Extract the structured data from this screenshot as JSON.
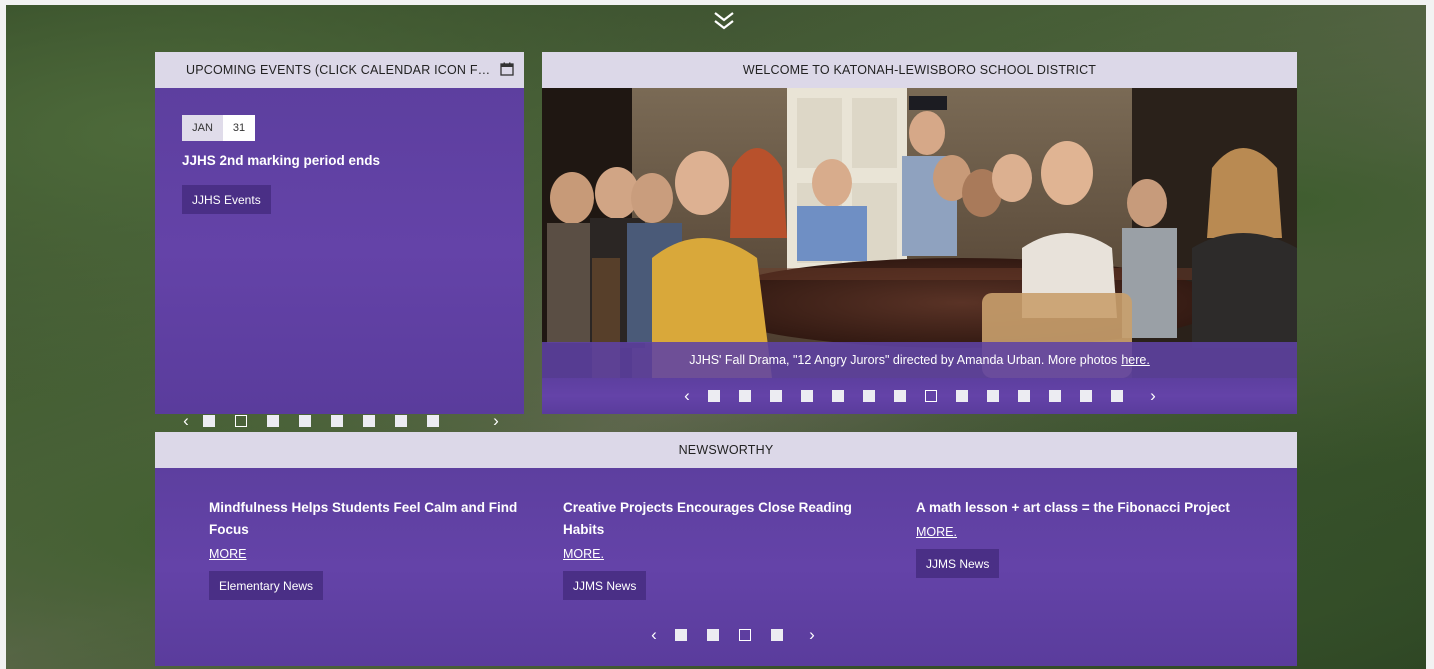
{
  "events": {
    "header": "UPCOMING EVENTS (CLICK CALENDAR ICON FOR ...",
    "event": {
      "month": "JAN",
      "day": "31",
      "title": "JJHS 2nd marking period ends",
      "tag": "JJHS Events"
    },
    "pager": {
      "prev": "‹",
      "next": "›",
      "count": 8,
      "active_index": 1
    }
  },
  "welcome": {
    "header": "WELCOME TO KATONAH-LEWISBORO SCHOOL DISTRICT",
    "caption": "JJHS' Fall Drama, \"12 Angry Jurors\" directed by Amanda Urban. More photos",
    "caption_link": "here.",
    "pager": {
      "prev": "‹",
      "next": "›",
      "count": 14,
      "active_index": 7
    }
  },
  "news": {
    "header": "NEWSWORTHY",
    "items": [
      {
        "headline": "Mindfulness Helps Students Feel Calm and Find Focus",
        "more": "MORE",
        "tag": "Elementary News"
      },
      {
        "headline": "Creative Projects Encourages Close Reading Habits",
        "more": "MORE.",
        "tag": "JJMS News"
      },
      {
        "headline": "A math lesson + art class = the Fibonacci Project",
        "more": "MORE.",
        "tag": "JJMS News"
      }
    ],
    "pager": {
      "prev": "‹",
      "next": "›",
      "count": 4,
      "active_index": 2
    }
  },
  "colors": {
    "purple": "#6443a8",
    "header_bg": "#dcd8e8",
    "tag_bg": "#4a2f86"
  }
}
